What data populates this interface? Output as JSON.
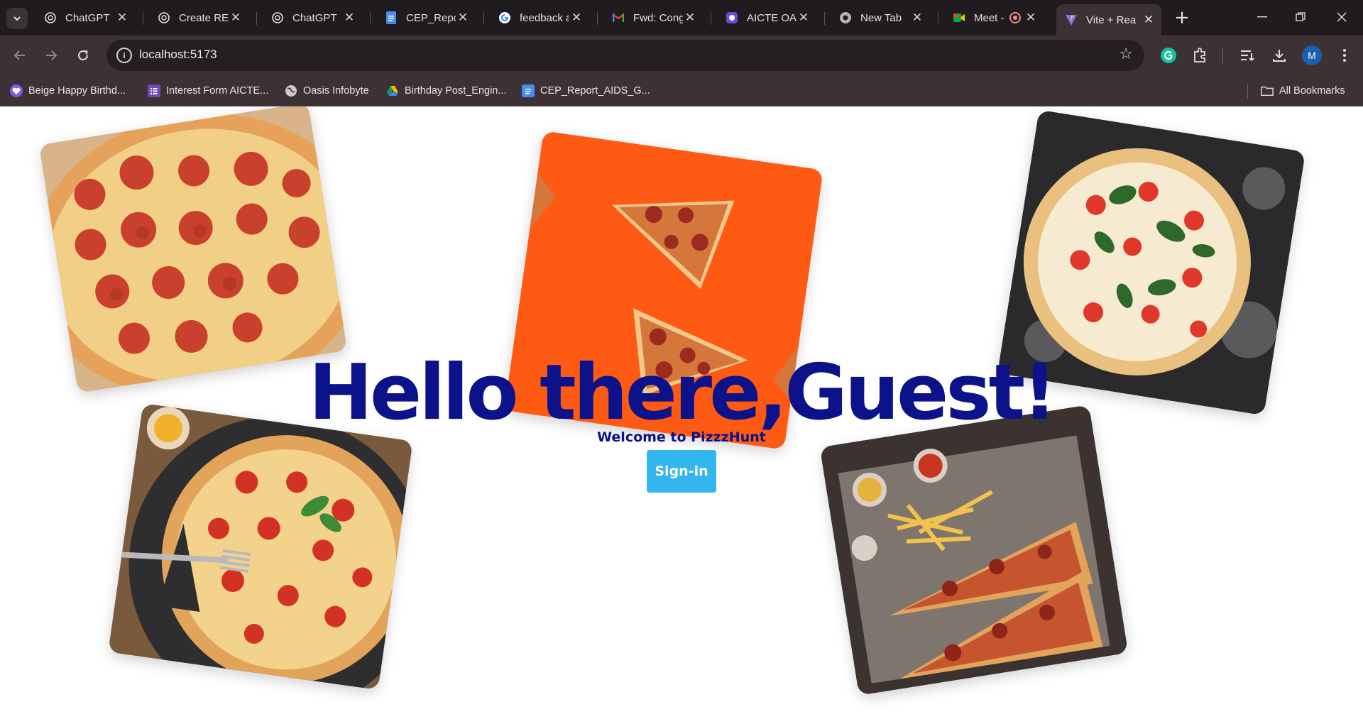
{
  "browser": {
    "tabs": [
      {
        "title": "ChatGPT",
        "icon": "chatgpt-icon"
      },
      {
        "title": "Create REA",
        "icon": "chatgpt-icon"
      },
      {
        "title": "ChatGPT",
        "icon": "chatgpt-icon"
      },
      {
        "title": "CEP_Repor",
        "icon": "google-docs-icon"
      },
      {
        "title": "feedback a",
        "icon": "google-icon"
      },
      {
        "title": "Fwd: Cong",
        "icon": "gmail-icon"
      },
      {
        "title": "AICTE OAS",
        "icon": "aicte-icon"
      },
      {
        "title": "New Tab",
        "icon": "chrome-icon"
      },
      {
        "title": "Meet -",
        "icon": "google-meet-icon"
      },
      {
        "title": "Vite + Rea",
        "icon": "vite-icon",
        "active": true
      }
    ],
    "new_tab_symbol": "+",
    "address": "localhost:5173",
    "avatar_letter": "M",
    "bookmarks": [
      {
        "label": "Beige Happy Birthd...",
        "icon": "canva-heart-icon"
      },
      {
        "label": "Interest Form AICTE...",
        "icon": "google-forms-icon"
      },
      {
        "label": "Oasis Infobyte",
        "icon": "globe-icon"
      },
      {
        "label": "Birthday Post_Engin...",
        "icon": "google-drive-icon"
      },
      {
        "label": "CEP_Report_AIDS_G...",
        "icon": "google-docs-icon"
      }
    ],
    "all_bookmarks_label": "All Bookmarks"
  },
  "page": {
    "title": "Hello there,Guest!",
    "subtitle": "Welcome to PizzzHunt",
    "signin_label": "Sign-in"
  },
  "colors": {
    "title_blue": "#0c128a",
    "button_blue": "#33b6f0",
    "chrome_dark": "#1f1b1f",
    "chrome_toolbar": "#3c3236"
  }
}
